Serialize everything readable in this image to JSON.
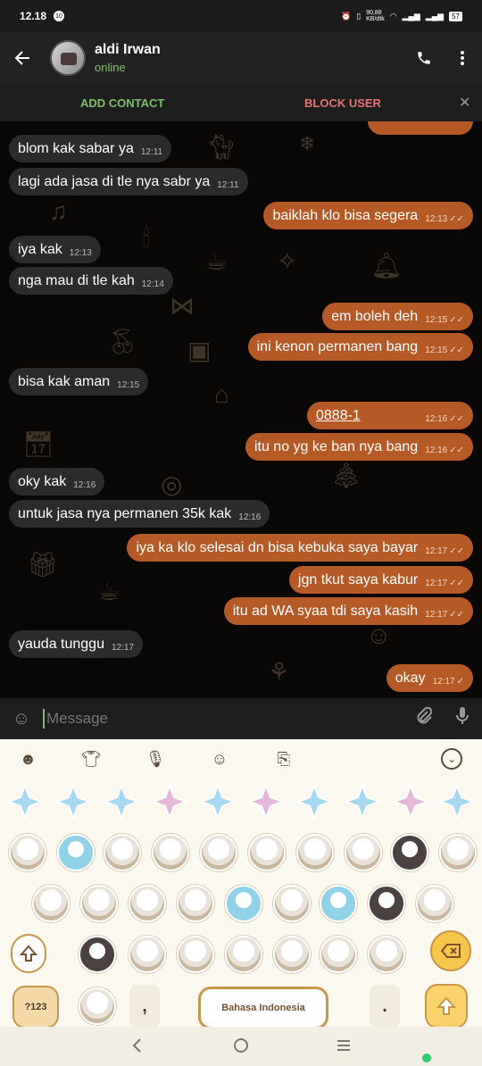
{
  "status": {
    "time": "12.18",
    "notif": "10",
    "speed": "90,88\nKB/dtk",
    "battery": "57"
  },
  "header": {
    "name": "aldi Irwan",
    "status": "online"
  },
  "actions": {
    "add_contact": "ADD CONTACT",
    "block_user": "BLOCK USER"
  },
  "messages": [
    {
      "dir": "in",
      "text": "blom kak sabar ya",
      "time": "12:11"
    },
    {
      "dir": "in",
      "text": "lagi ada jasa di tle nya sabr ya",
      "time": "12:11"
    },
    {
      "dir": "out",
      "text": "baiklah klo bisa segera",
      "time": "12:13"
    },
    {
      "dir": "in",
      "text": "iya kak",
      "time": "12:13"
    },
    {
      "dir": "in",
      "text": "nga mau di tle kah",
      "time": "12:14"
    },
    {
      "dir": "out",
      "text": "em boleh deh",
      "time": "12:15"
    },
    {
      "dir": "out",
      "text": "ini kenon permanen bang",
      "time": "12:15"
    },
    {
      "dir": "in",
      "text": "bisa kak aman",
      "time": "12:15"
    },
    {
      "dir": "out",
      "text": "0888-1",
      "time": "12:16"
    },
    {
      "dir": "out",
      "text": "itu no yg ke ban nya bang",
      "time": "12:16"
    },
    {
      "dir": "in",
      "text": "oky kak",
      "time": "12:16"
    },
    {
      "dir": "in",
      "text": "untuk jasa nya permanen 35k kak",
      "time": "12:16"
    },
    {
      "dir": "out",
      "text": "iya ka klo selesai dn bisa kebuka saya bayar",
      "time": "12:17"
    },
    {
      "dir": "out",
      "text": "jgn tkut saya kabur",
      "time": "12:17"
    },
    {
      "dir": "out",
      "text": "itu ad WA syaa tdi saya kasih",
      "time": "12:17"
    },
    {
      "dir": "in",
      "text": "yauda tunggu",
      "time": "12:17"
    },
    {
      "dir": "out",
      "text": "okay",
      "time": "12:17"
    }
  ],
  "input": {
    "placeholder": "Message"
  },
  "keyboard": {
    "num_key": "?123",
    "comma": ",",
    "period": ".",
    "space_label": "Bahasa Indonesia"
  },
  "colors": {
    "out_bubble": "#b55a26",
    "in_bubble": "#2b2b2b",
    "accent": "#7fbf6a"
  }
}
